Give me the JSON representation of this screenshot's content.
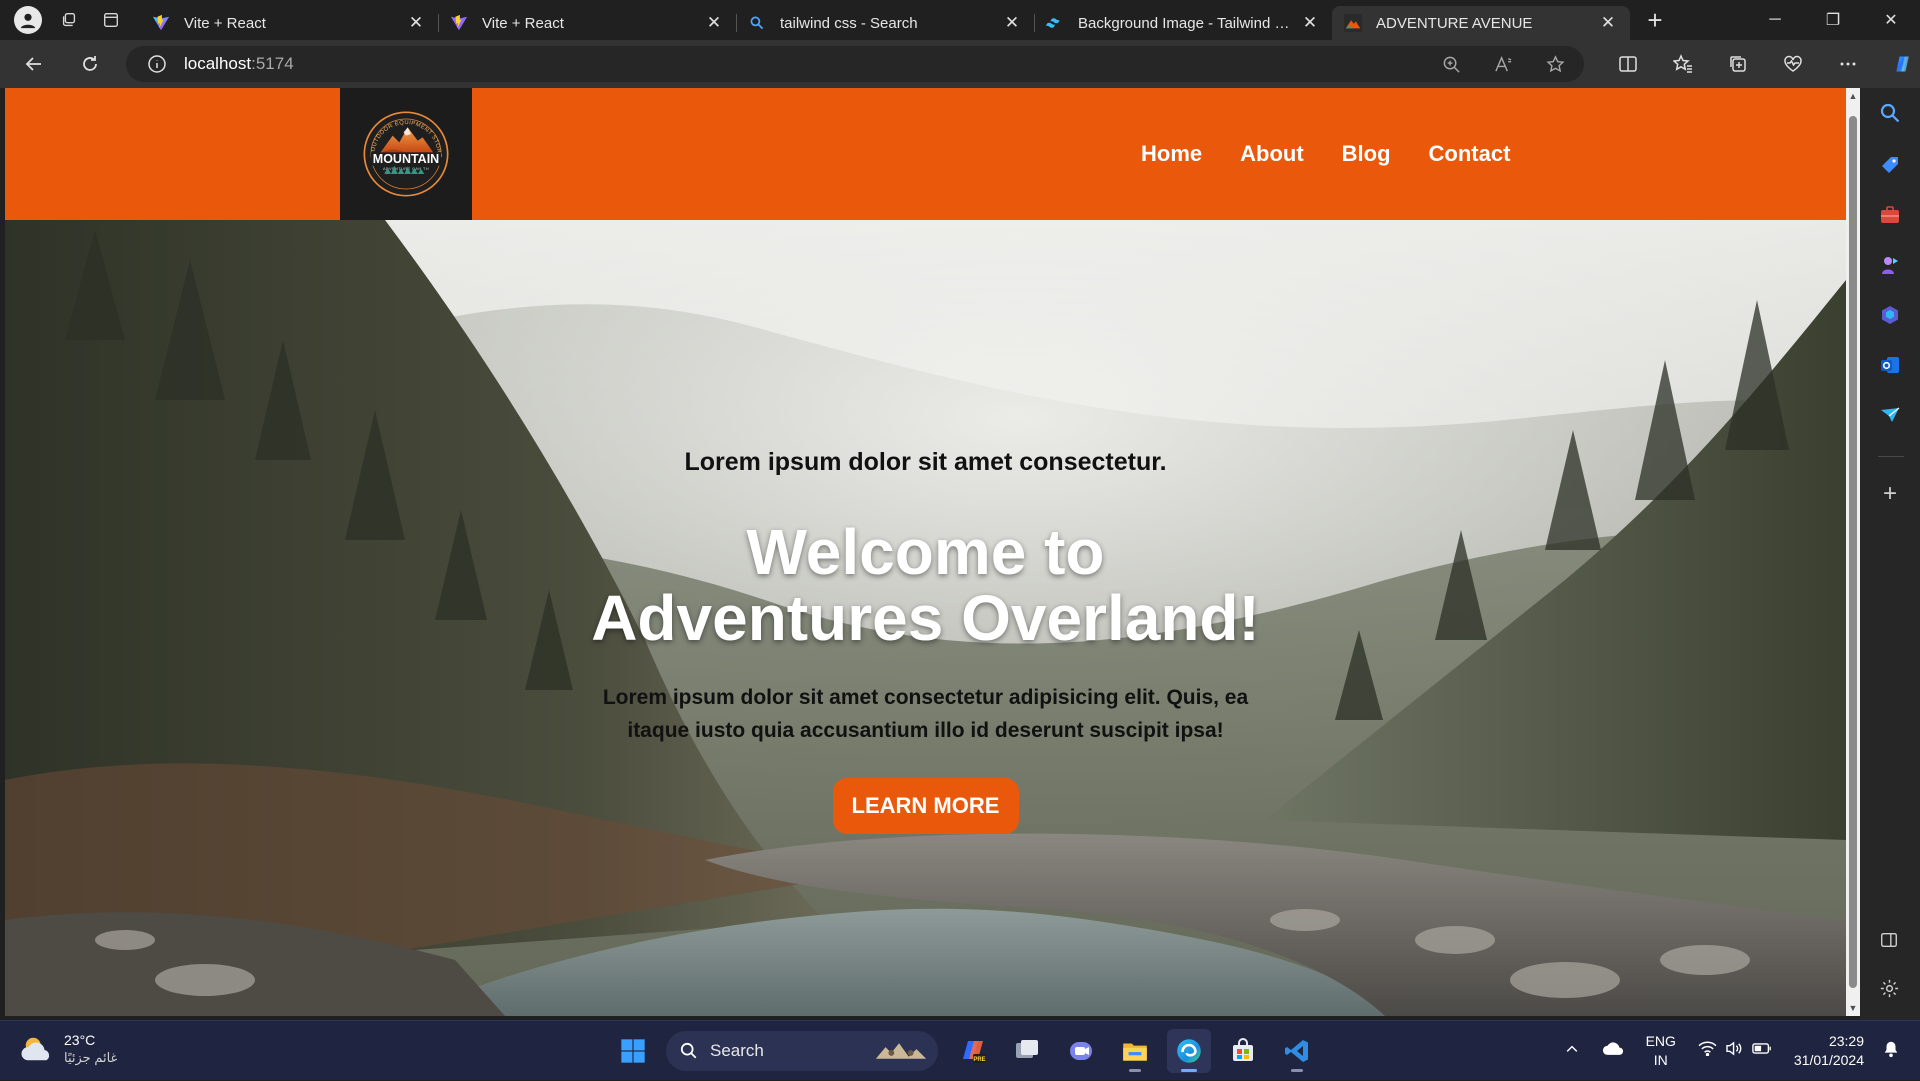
{
  "browser": {
    "tabs": [
      {
        "title": "Vite + React",
        "favicon": "vite-icon",
        "active": false
      },
      {
        "title": "Vite + React",
        "favicon": "vite-icon",
        "active": false
      },
      {
        "title": "tailwind css - Search",
        "favicon": "search-icon",
        "active": false
      },
      {
        "title": "Background Image - Tailwind CSS",
        "favicon": "tailwind-icon",
        "active": false
      },
      {
        "title": "ADVENTURE AVENUE",
        "favicon": "mountain-logo-icon",
        "active": true
      }
    ],
    "new_tab_label": "+",
    "address": {
      "host": "localhost",
      "port": ":5174"
    }
  },
  "site": {
    "logo": {
      "main_text": "MOUNTAIN",
      "arc_text": "OUTDOOR EQUIPMENT STORE",
      "sub_text": "ADVENTURE CAN TH"
    },
    "nav": [
      "Home",
      "About",
      "Blog",
      "Contact"
    ],
    "hero": {
      "kicker": "Lorem ipsum dolor sit amet consectetur.",
      "title_line1": "Welcome to",
      "title_line2": "Adventures Overland!",
      "text": "Lorem ipsum dolor sit amet consectetur adipisicing elit. Quis, ea itaque iusto quia accusantium illo id deserunt suscipit ipsa!",
      "button": "LEARN MORE"
    }
  },
  "taskbar": {
    "weather": {
      "temp": "23°C",
      "condition": "غائم جزئيًا"
    },
    "search_label": "Search",
    "language": {
      "line1": "ENG",
      "line2": "IN"
    },
    "clock": {
      "time": "23:29",
      "date": "31/01/2024"
    }
  },
  "colors": {
    "brand_orange": "#ea580c",
    "logo_bg": "#1c1c1c",
    "taskbar": "#1f2440"
  }
}
